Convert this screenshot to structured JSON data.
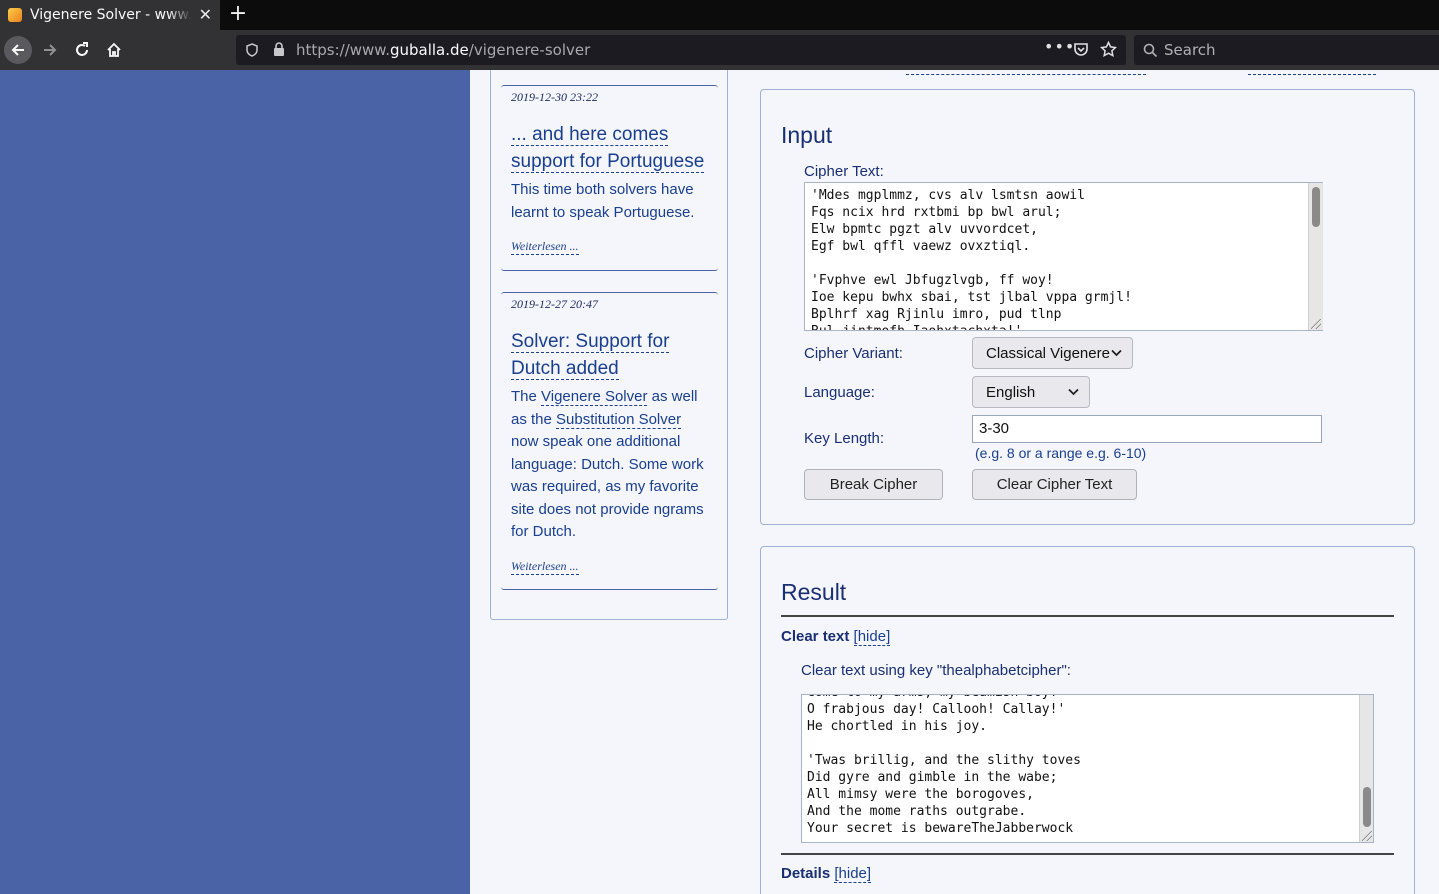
{
  "browser": {
    "tab_title": "Vigenere Solver - www.guballa.de",
    "url_prefix": "https://www.",
    "url_domain": "guballa.de",
    "url_path": "/vigenere-solver",
    "search_placeholder": "Search",
    "new_tab": "+",
    "close_tab": "✕"
  },
  "sidebar": {
    "news": [
      {
        "date": "2019-12-30 23:22",
        "title_line1": "... and here comes",
        "title_line2": "support for Portuguese",
        "body": "This time both solvers have learnt to speak Portuguese.",
        "more": "Weiterlesen ..."
      },
      {
        "date": "2019-12-27 20:47",
        "title_line1": "Solver: Support for",
        "title_line2": "Dutch added",
        "body_pre": "The ",
        "body_link1": "Vigenere Solver",
        "body_mid1": " as well as the ",
        "body_link2": "Substitution Solver",
        "body_post": " now speak one additional language: Dutch. Some work was required, as my favorite site does not provide ngrams for Dutch.",
        "more": "Weiterlesen ..."
      }
    ]
  },
  "input": {
    "heading": "Input",
    "cipher_label": "Cipher Text:",
    "cipher_text": "'Mdes mgplmmz, cvs alv lsmtsn aowil\nFqs ncix hrd rxtbmi bp bwl arul;\nElw bpmtc pgzt alv uvvordcet,\nEgf bwl qffl vaewz ovxztiql.\n\n'Fvphve ewl Jbfugzlvgb, ff woy!\nIoe kepu bwhx sbai, tst jlbal vppa grmjl!\nBplhrf xag Rjinlu imro, pud tlnp\nBul jintmofh Iaohxtachxta!'",
    "variant_label": "Cipher Variant:",
    "variant_value": "Classical Vigenere",
    "language_label": "Language:",
    "language_value": "English",
    "keylength_label": "Key Length:",
    "keylength_value": "3-30",
    "keylength_hint": "(e.g. 8 or a range e.g. 6-10)",
    "break_button": "Break Cipher",
    "clear_button": "Clear Cipher Text"
  },
  "result": {
    "heading": "Result",
    "clear_text_label": "Clear text",
    "hide_link": "[hide]",
    "key_line": "Clear text using key \"thealphabetcipher\":",
    "clear_text": "Come to my arms, my beamish boy!\nO frabjous day! Callooh! Callay!'\nHe chortled in his joy.\n\n'Twas brillig, and the slithy toves\nDid gyre and gimble in the wabe;\nAll mimsy were the borogoves,\nAnd the mome raths outgrabe.\nYour secret is bewareTheJabberwock",
    "details_label": "Details",
    "details_hide": "[hide]"
  }
}
